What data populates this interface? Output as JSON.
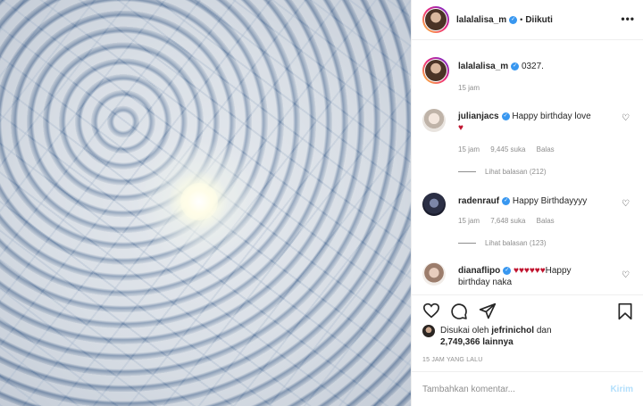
{
  "photo": {
    "alt": ""
  },
  "header": {
    "username": "lalalalisa_m",
    "separator": "•",
    "follow_label": "Diikuti",
    "more_label": "•••"
  },
  "caption": {
    "username": "lalalalisa_m",
    "text": "0327.",
    "time": "15 jam"
  },
  "comments": [
    {
      "username": "julianjacs",
      "text": "Happy birthday love",
      "heart": "♥",
      "time": "15 jam",
      "likes": "9,445 suka",
      "reply": "Balas",
      "view_replies": "Lihat balasan (212)"
    },
    {
      "username": "radenrauf",
      "text": "Happy Birthdayyyy",
      "time": "15 jam",
      "likes": "7,648 suka",
      "reply": "Balas",
      "view_replies": "Lihat balasan (123)"
    },
    {
      "username": "dianaflipo",
      "hearts": "♥♥♥♥♥♥",
      "text_a": "Happy",
      "text_b": "birthday naka"
    }
  ],
  "likes": {
    "prefix": "Disukai oleh",
    "user": "jefrinichol",
    "and": "dan",
    "count": "2,749,366 lainnya"
  },
  "post_time": "15 JAM YANG LALU",
  "comment_box": {
    "placeholder": "Tambahkan komentar...",
    "send_label": "Kirim"
  },
  "icons": {
    "like": "heart-outline-icon",
    "comment": "comment-icon",
    "share": "share-icon",
    "save": "bookmark-icon",
    "verified": "verified-badge-icon",
    "more": "more-icon"
  },
  "colors": {
    "verified": "#3897f0",
    "send": "#b2dffc",
    "heart": "#c0132e"
  }
}
